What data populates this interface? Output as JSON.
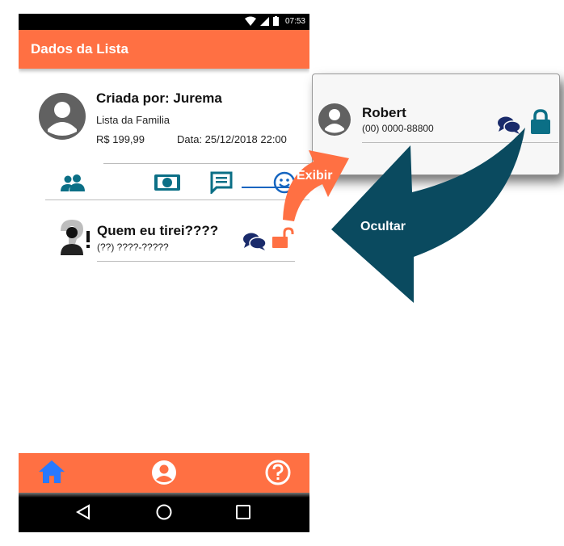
{
  "status_bar": {
    "time": "07:53"
  },
  "app_bar": {
    "title": "Dados da Lista"
  },
  "list_info": {
    "creator_label": "Criada por: Jurema",
    "list_name": "Lista da Familia",
    "price": "R$ 199,99",
    "date": "Data: 25/12/2018 22:00"
  },
  "tabs": [
    {
      "icon": "people-icon"
    },
    {
      "icon": "money-icon"
    },
    {
      "icon": "message-icon"
    },
    {
      "icon": "smiley-icon",
      "selected": true
    }
  ],
  "mystery_row": {
    "name": "Quem eu tirei????",
    "phone": "(??) ????-?????"
  },
  "revealed_card": {
    "name": "Robert",
    "phone": "(00) 0000-88800"
  },
  "annotations": {
    "show_label": "Exibir",
    "hide_label": "Ocultar"
  },
  "colors": {
    "accent": "#ff7043",
    "teal": "#0b6f86",
    "dark_arrow": "#0a4a5f",
    "navy": "#1a2b6b"
  }
}
